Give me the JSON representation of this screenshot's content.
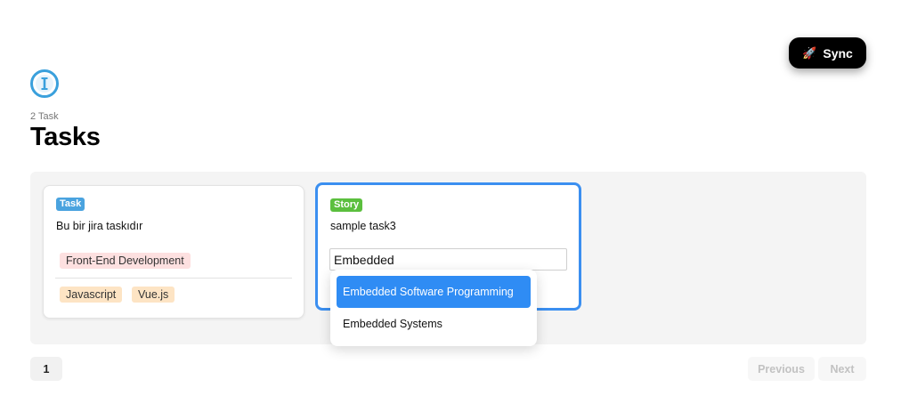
{
  "header": {
    "sync_label": "Sync",
    "sync_icon": "rocket-icon",
    "logo_icon": "info-circle-icon",
    "logo_color": "#3aa0dc",
    "task_count": "2 Task",
    "title": "Tasks"
  },
  "cards": [
    {
      "badge": "Task",
      "badge_color": "#4aa3df",
      "text": "Bu bir jira taskıdır",
      "category_tag": "Front-End Development",
      "skill_tags": [
        "Javascript",
        "Vue.js"
      ]
    },
    {
      "badge": "Story",
      "badge_color": "#5bbf3e",
      "text": "sample task3",
      "input_value": "Embedded",
      "suggestions": [
        "Embedded Software Programming",
        "Embedded Systems"
      ],
      "highlight_color": "#2f8cf4"
    }
  ],
  "pagination": {
    "current_page": "1",
    "previous_label": "Previous",
    "next_label": "Next"
  }
}
